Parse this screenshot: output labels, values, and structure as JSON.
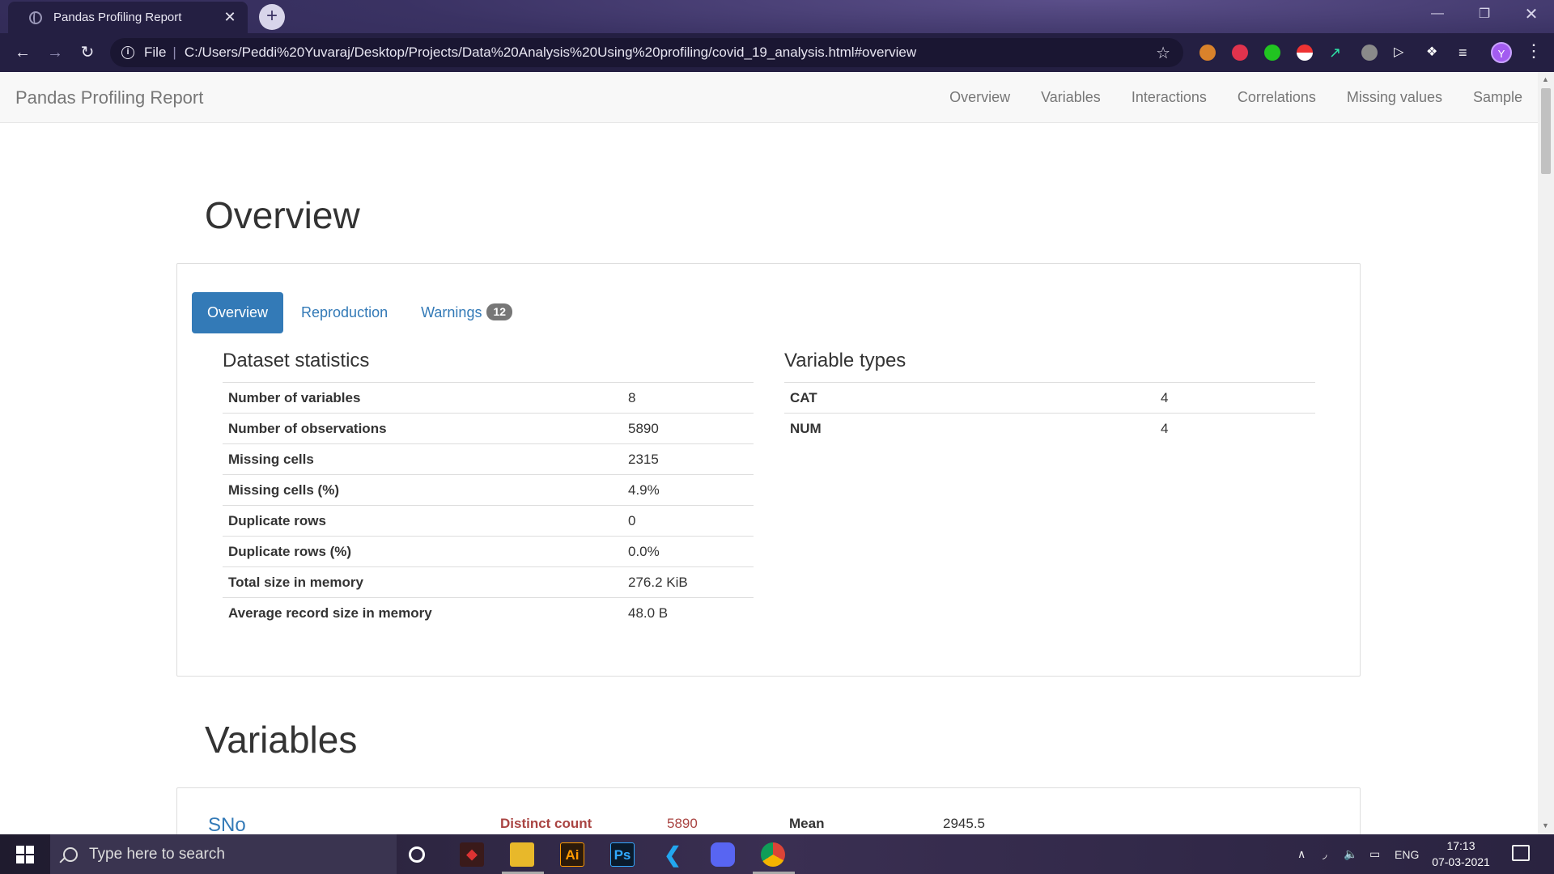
{
  "browser": {
    "tab_title": "Pandas Profiling Report",
    "tab_close": "✕",
    "new_tab": "+",
    "url_scheme": "File",
    "url_sep": "|",
    "url": "C:/Users/Peddi%20Yuvaraj/Desktop/Projects/Data%20Analysis%20Using%20profiling/covid_19_analysis.html#overview",
    "profile_initial": "Y"
  },
  "navbar": {
    "brand": "Pandas Profiling Report",
    "links": [
      "Overview",
      "Variables",
      "Interactions",
      "Correlations",
      "Missing values",
      "Sample"
    ]
  },
  "overview": {
    "heading": "Overview",
    "tabs": [
      "Overview",
      "Reproduction",
      "Warnings"
    ],
    "warnings_count": "12",
    "dataset_statistics": {
      "title": "Dataset statistics",
      "rows": [
        {
          "label": "Number of variables",
          "value": "8"
        },
        {
          "label": "Number of observations",
          "value": "5890"
        },
        {
          "label": "Missing cells",
          "value": "2315"
        },
        {
          "label": "Missing cells (%)",
          "value": "4.9%"
        },
        {
          "label": "Duplicate rows",
          "value": "0"
        },
        {
          "label": "Duplicate rows (%)",
          "value": "0.0%"
        },
        {
          "label": "Total size in memory",
          "value": "276.2 KiB"
        },
        {
          "label": "Average record size in memory",
          "value": "48.0 B"
        }
      ]
    },
    "variable_types": {
      "title": "Variable types",
      "rows": [
        {
          "label": "CAT",
          "value": "4"
        },
        {
          "label": "NUM",
          "value": "4"
        }
      ]
    }
  },
  "variables": {
    "heading": "Variables",
    "first_var_name": "SNo",
    "distinct_label": "Distinct count",
    "distinct_value": "5890",
    "mean_label": "Mean",
    "mean_value": "2945.5"
  },
  "taskbar": {
    "search_placeholder": "Type here to search",
    "lang": "ENG",
    "time": "17:13",
    "date": "07-03-2021"
  }
}
